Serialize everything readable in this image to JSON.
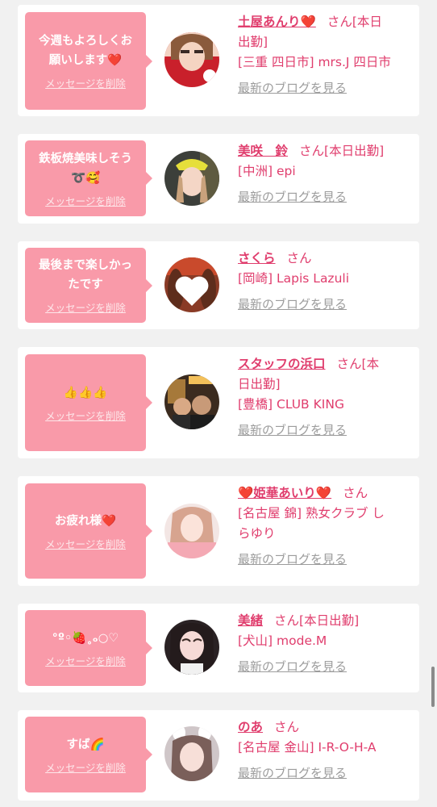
{
  "delete_label": "メッセージを削除",
  "blog_label": "最新のブログを見る",
  "san_suffix": "さん",
  "accent_color": "#f99aa9",
  "link_color": "#e03d6d",
  "entries": [
    {
      "message_line1": "今週もよろしくお",
      "message_line2": "願いします❤️",
      "name": "土屋あんり❤️",
      "san_tail": "[本日",
      "line2": "出勤]",
      "line3": "[三重 四日市] mrs.J 四日市"
    },
    {
      "message_line1": "鉄板焼美味しそう",
      "message_line2": "➰🥰",
      "name": "美咲　鈴",
      "san_tail": "[本日出勤]",
      "line2": "[中洲] epi"
    },
    {
      "message_line1": "最後まで楽しかっ",
      "message_line2": "たです",
      "name": "さくら",
      "line2": "[岡崎] Lapis Lazuli"
    },
    {
      "message_line1": "👍👍👍",
      "name": "スタッフの浜口",
      "san_tail": "[本",
      "line2": "日出勤]",
      "line3": "[豊橋] CLUB KING"
    },
    {
      "message_line1": "お疲れ様❤️",
      "name": "❤️姫華あいり❤️",
      "line2": "[名古屋 錦] 熟女クラブ し",
      "line3": "らゆり"
    },
    {
      "message_line1": "°º◦🍓˳ₒ○♡",
      "name": "美緒",
      "san_tail": "[本日出勤]",
      "line2": "[犬山] mode.M"
    },
    {
      "message_line1": "すば🌈",
      "name": "のあ",
      "line2": "[名古屋 金山] I-R-O-H-A"
    }
  ]
}
